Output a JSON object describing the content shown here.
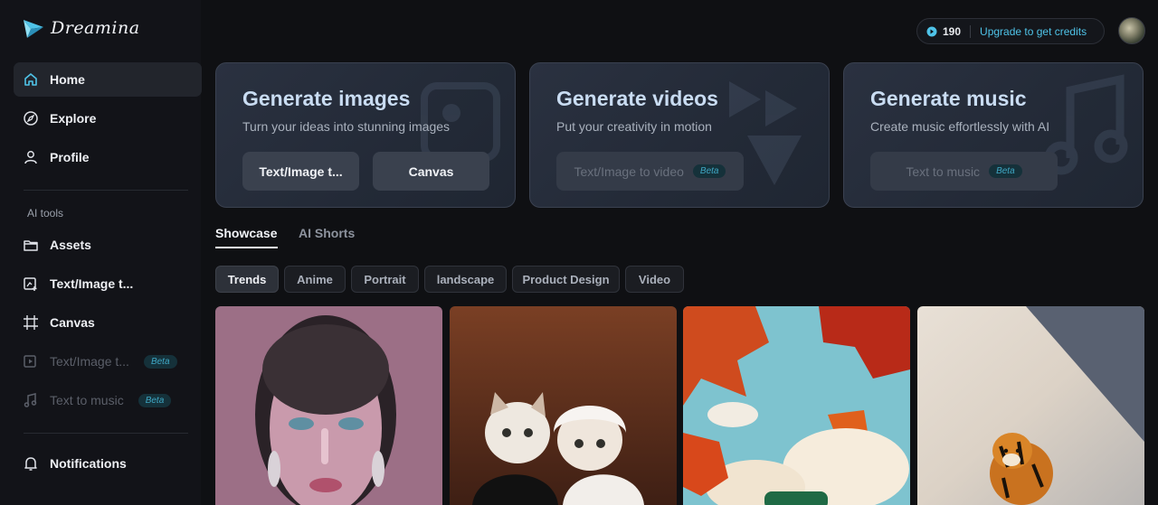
{
  "app": {
    "name": "Dreamina"
  },
  "sidebar": {
    "nav": [
      {
        "label": "Home"
      },
      {
        "label": "Explore"
      },
      {
        "label": "Profile"
      }
    ],
    "section_label": "AI tools",
    "tools": [
      {
        "label": "Assets"
      },
      {
        "label": "Text/Image t..."
      },
      {
        "label": "Canvas"
      },
      {
        "label": "Text/Image t...",
        "badge": "Beta"
      },
      {
        "label": "Text to music",
        "badge": "Beta"
      }
    ],
    "notifications": "Notifications"
  },
  "header": {
    "credits": "190",
    "upgrade": "Upgrade to get credits"
  },
  "cards": [
    {
      "title": "Generate images",
      "subtitle": "Turn your ideas into stunning images",
      "buttons": [
        "Text/Image t...",
        "Canvas"
      ]
    },
    {
      "title": "Generate videos",
      "subtitle": "Put your creativity in motion",
      "buttons": [
        "Text/Image to video"
      ],
      "badge": "Beta"
    },
    {
      "title": "Generate music",
      "subtitle": "Create music effortlessly with AI",
      "buttons": [
        "Text to music"
      ],
      "badge": "Beta"
    }
  ],
  "tabs": [
    "Showcase",
    "AI Shorts"
  ],
  "chips": [
    "Trends",
    "Anime",
    "Portrait",
    "landscape",
    "Product Design",
    "Video"
  ],
  "colors": {
    "accent": "#4fc3e8",
    "card_title": "#c9dcf2",
    "background": "#0f1013"
  }
}
